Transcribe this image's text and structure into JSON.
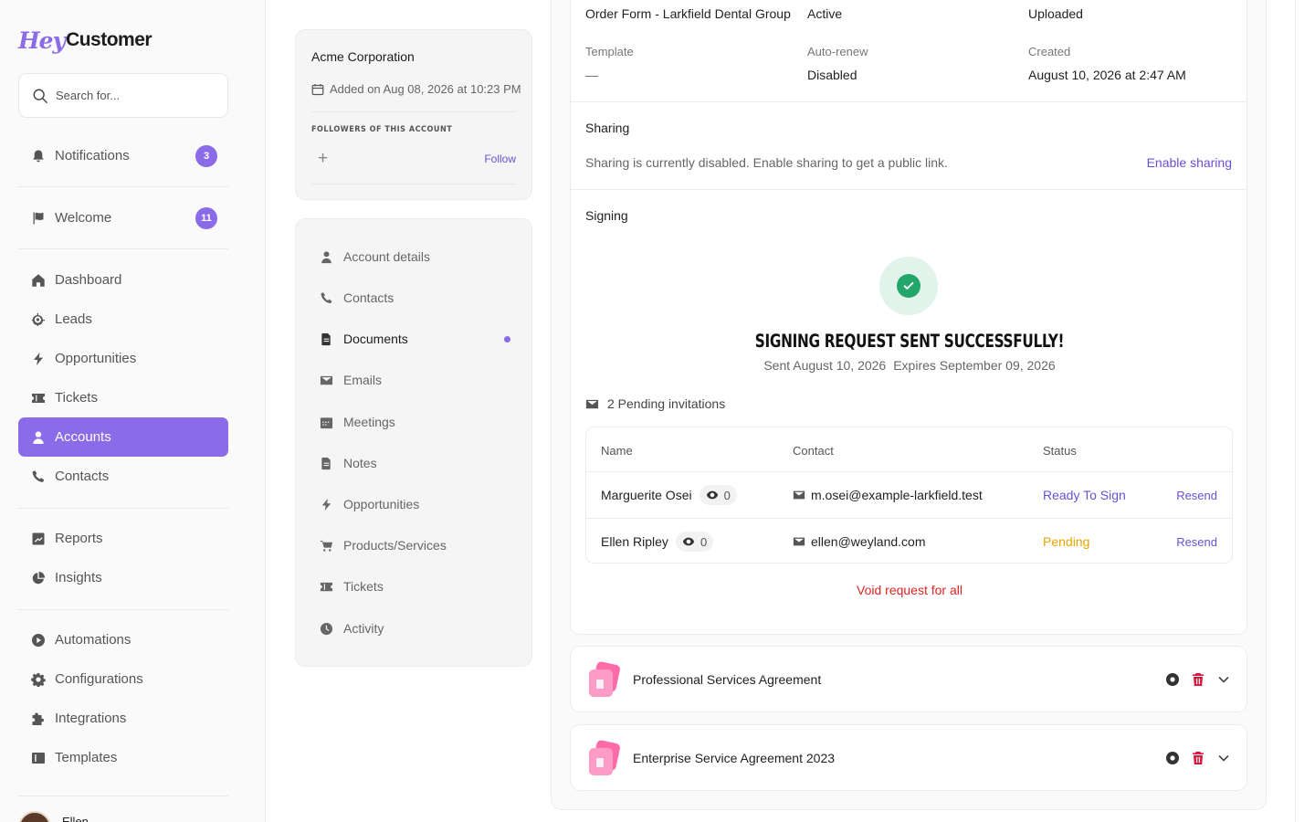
{
  "brand": {
    "logo_prefix": "Hey",
    "logo_name": "Customer"
  },
  "search": {
    "placeholder": "Search for..."
  },
  "sidebar": {
    "items": [
      {
        "key": "notifications",
        "label": "Notifications",
        "badge": "3"
      },
      {
        "key": "welcome",
        "label": "Welcome",
        "badge": "11"
      },
      {
        "key": "dashboard",
        "label": "Dashboard"
      },
      {
        "key": "leads",
        "label": "Leads"
      },
      {
        "key": "opportunities",
        "label": "Opportunities"
      },
      {
        "key": "tickets",
        "label": "Tickets"
      },
      {
        "key": "accounts",
        "label": "Accounts",
        "active": true
      },
      {
        "key": "contacts",
        "label": "Contacts"
      },
      {
        "key": "reports",
        "label": "Reports"
      },
      {
        "key": "insights",
        "label": "Insights"
      },
      {
        "key": "automations",
        "label": "Automations"
      },
      {
        "key": "configurations",
        "label": "Configurations"
      },
      {
        "key": "integrations",
        "label": "Integrations"
      },
      {
        "key": "templates",
        "label": "Templates"
      }
    ],
    "user_name": "Ellen"
  },
  "account": {
    "name": "Acme Corporation",
    "added": "Added on Aug 08, 2026 at 10:23 PM",
    "followers_title": "FOLLOWERS OF THIS ACCOUNT",
    "follow_label": "Follow"
  },
  "tabs": [
    {
      "key": "account-details",
      "label": "Account details"
    },
    {
      "key": "contacts",
      "label": "Contacts"
    },
    {
      "key": "documents",
      "label": "Documents",
      "active": true
    },
    {
      "key": "emails",
      "label": "Emails"
    },
    {
      "key": "meetings",
      "label": "Meetings"
    },
    {
      "key": "notes",
      "label": "Notes"
    },
    {
      "key": "opportunities",
      "label": "Opportunities"
    },
    {
      "key": "products-services",
      "label": "Products/Services"
    },
    {
      "key": "tickets",
      "label": "Tickets"
    },
    {
      "key": "activity",
      "label": "Activity"
    }
  ],
  "document": {
    "name": "Order Form - Larkfield Dental Group",
    "status": "Active",
    "source": "Uploaded",
    "template_label": "Template",
    "template_value": "—",
    "autorenew_label": "Auto-renew",
    "autorenew_value": "Disabled",
    "created_label": "Created",
    "created_value": "August 10, 2026 at 2:47 AM"
  },
  "sharing": {
    "title": "Sharing",
    "text": "Sharing is currently disabled. Enable sharing to get a public link.",
    "enable_label": "Enable sharing"
  },
  "signing": {
    "title": "Signing",
    "success_title": "SIGNING REQUEST SENT SUCCESSFULLY!",
    "sent": "Sent August 10, 2026",
    "expires": "Expires September 09, 2026",
    "pending": "2 Pending invitations",
    "columns": {
      "name": "Name",
      "contact": "Contact",
      "status": "Status"
    },
    "rows": [
      {
        "name": "Marguerite Osei",
        "views": "0",
        "email": "m.osei@example-larkfield.test",
        "status": "Ready To Sign",
        "action": "Resend"
      },
      {
        "name": "Ellen Ripley",
        "views": "0",
        "email": "ellen@weyland.com",
        "status": "Pending",
        "action": "Resend"
      }
    ],
    "void_label": "Void request for all"
  },
  "other_documents": [
    {
      "title": "Professional Services Agreement"
    },
    {
      "title": "Enterprise Service Agreement 2023"
    }
  ],
  "colors": {
    "accent": "#8b6be8",
    "link": "#6b4fd8",
    "success": "#23a66a",
    "danger": "#e02424",
    "warning": "#e5a300"
  }
}
